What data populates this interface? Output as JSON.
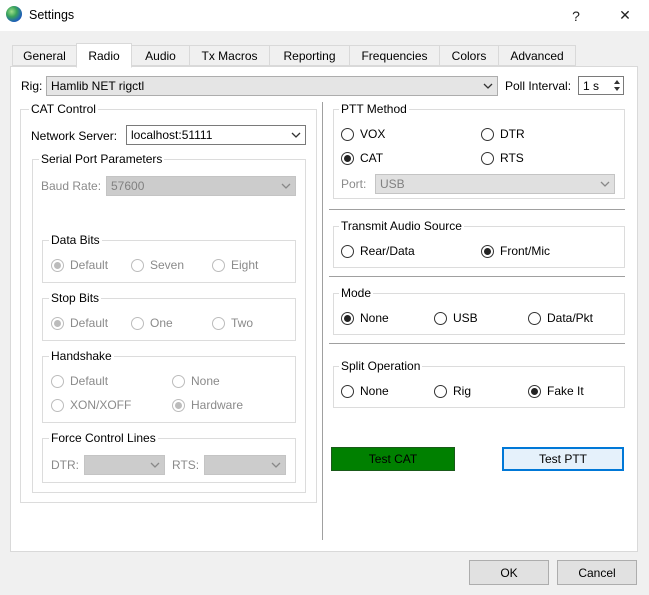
{
  "window": {
    "title": "Settings",
    "help_glyph": "?",
    "close_glyph": "✕"
  },
  "tabs": [
    {
      "label": "General"
    },
    {
      "label": "Radio"
    },
    {
      "label": "Audio"
    },
    {
      "label": "Tx Macros"
    },
    {
      "label": "Reporting"
    },
    {
      "label": "Frequencies"
    },
    {
      "label": "Colors"
    },
    {
      "label": "Advanced"
    }
  ],
  "active_tab": "Radio",
  "rig": {
    "label": "Rig:",
    "value": "Hamlib NET rigctl"
  },
  "poll": {
    "label": "Poll Interval:",
    "value": "1 s"
  },
  "cat": {
    "title": "CAT Control",
    "network_server": {
      "label": "Network Server:",
      "value": "localhost:51111"
    },
    "serial": {
      "title": "Serial Port Parameters",
      "baud": {
        "label": "Baud Rate:",
        "value": "57600"
      },
      "data_bits": {
        "title": "Data Bits",
        "options": [
          "Default",
          "Seven",
          "Eight"
        ],
        "selected": "Default"
      },
      "stop_bits": {
        "title": "Stop Bits",
        "options": [
          "Default",
          "One",
          "Two"
        ],
        "selected": "Default"
      },
      "handshake": {
        "title": "Handshake",
        "options": [
          "Default",
          "None",
          "XON/XOFF",
          "Hardware"
        ],
        "selected": "Hardware"
      },
      "force": {
        "title": "Force Control Lines",
        "dtr_label": "DTR:",
        "rts_label": "RTS:"
      }
    }
  },
  "ptt": {
    "title": "PTT Method",
    "options": [
      "VOX",
      "DTR",
      "CAT",
      "RTS"
    ],
    "selected": "CAT",
    "port": {
      "label": "Port:",
      "value": "USB"
    }
  },
  "audio_source": {
    "title": "Transmit Audio Source",
    "options": [
      "Rear/Data",
      "Front/Mic"
    ],
    "selected": "Front/Mic"
  },
  "mode": {
    "title": "Mode",
    "options": [
      "None",
      "USB",
      "Data/Pkt"
    ],
    "selected": "None"
  },
  "split": {
    "title": "Split Operation",
    "options": [
      "None",
      "Rig",
      "Fake It"
    ],
    "selected": "Fake It"
  },
  "buttons": {
    "test_cat": "Test CAT",
    "test_ptt": "Test PTT",
    "ok": "OK",
    "cancel": "Cancel"
  },
  "colors": {
    "test_cat_bg": "#008000",
    "focus_border": "#0078d7"
  }
}
